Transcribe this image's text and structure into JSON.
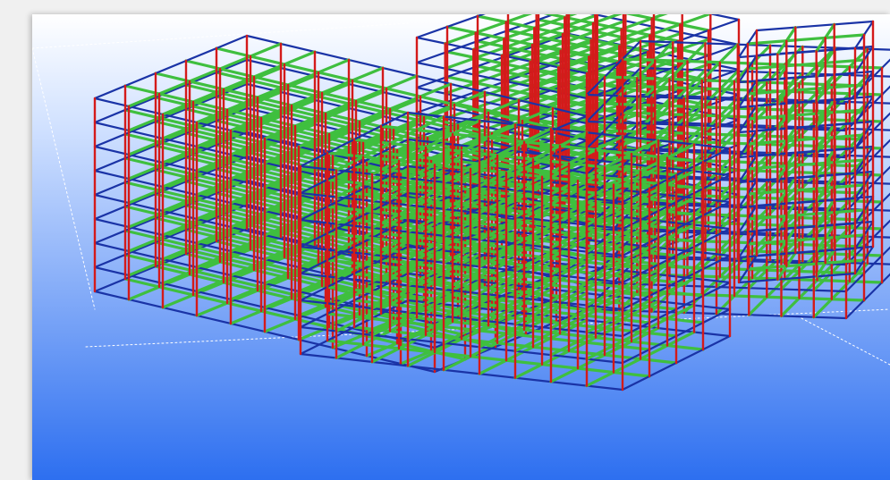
{
  "viewport": {
    "background_top": "#ffffff",
    "background_bottom": "#2d6ff0"
  },
  "members": {
    "beam_color": "#3fbf3f",
    "beam_edge_color": "#1f7a1f",
    "column_color": "#d41a1a",
    "perimeter_color": "#1a33a6",
    "guide_color": "#ffffff"
  }
}
